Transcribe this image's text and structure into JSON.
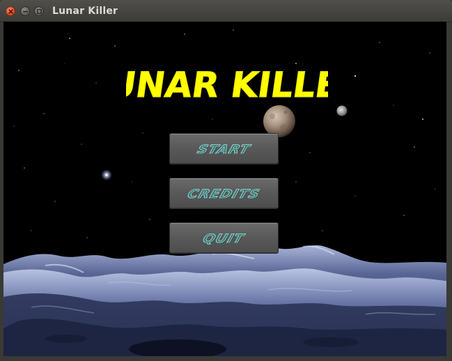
{
  "window": {
    "title": "Lunar Killer"
  },
  "game": {
    "logo_text": "LUNAR KILLER",
    "menu": {
      "start_label": "START",
      "credits_label": "CREDITS",
      "quit_label": "QUIT"
    }
  },
  "colors": {
    "titlebar": "#3c3b37",
    "close_button": "#e2502c",
    "logo": "#ffff00",
    "button_face": "#5a5a5a",
    "button_text": "#3d7c78"
  },
  "icons": {
    "close": "close-icon",
    "minimize": "minimize-icon",
    "maximize": "maximize-icon"
  }
}
